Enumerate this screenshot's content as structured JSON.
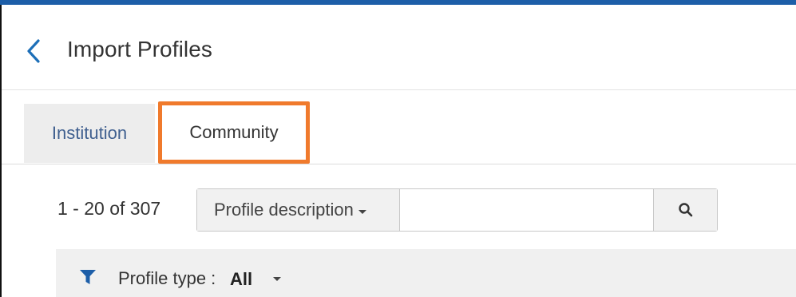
{
  "header": {
    "title": "Import Profiles",
    "back_icon": "chevron-left-icon"
  },
  "tabs": [
    {
      "label": "Institution",
      "active": false
    },
    {
      "label": "Community",
      "active": true,
      "highlight_color": "#f07a2c"
    }
  ],
  "results": {
    "count_text": "1 - 20 of 307"
  },
  "search": {
    "field_select_label": "Profile description",
    "query_value": "",
    "search_icon": "search-icon"
  },
  "filters": {
    "icon": "filter-icon",
    "label": "Profile type :",
    "value": "All"
  },
  "colors": {
    "accent": "#1d5ea8",
    "highlight": "#f07a2c",
    "tab_inactive_bg": "#ededed",
    "filter_bar_bg": "#f0f0f0"
  }
}
